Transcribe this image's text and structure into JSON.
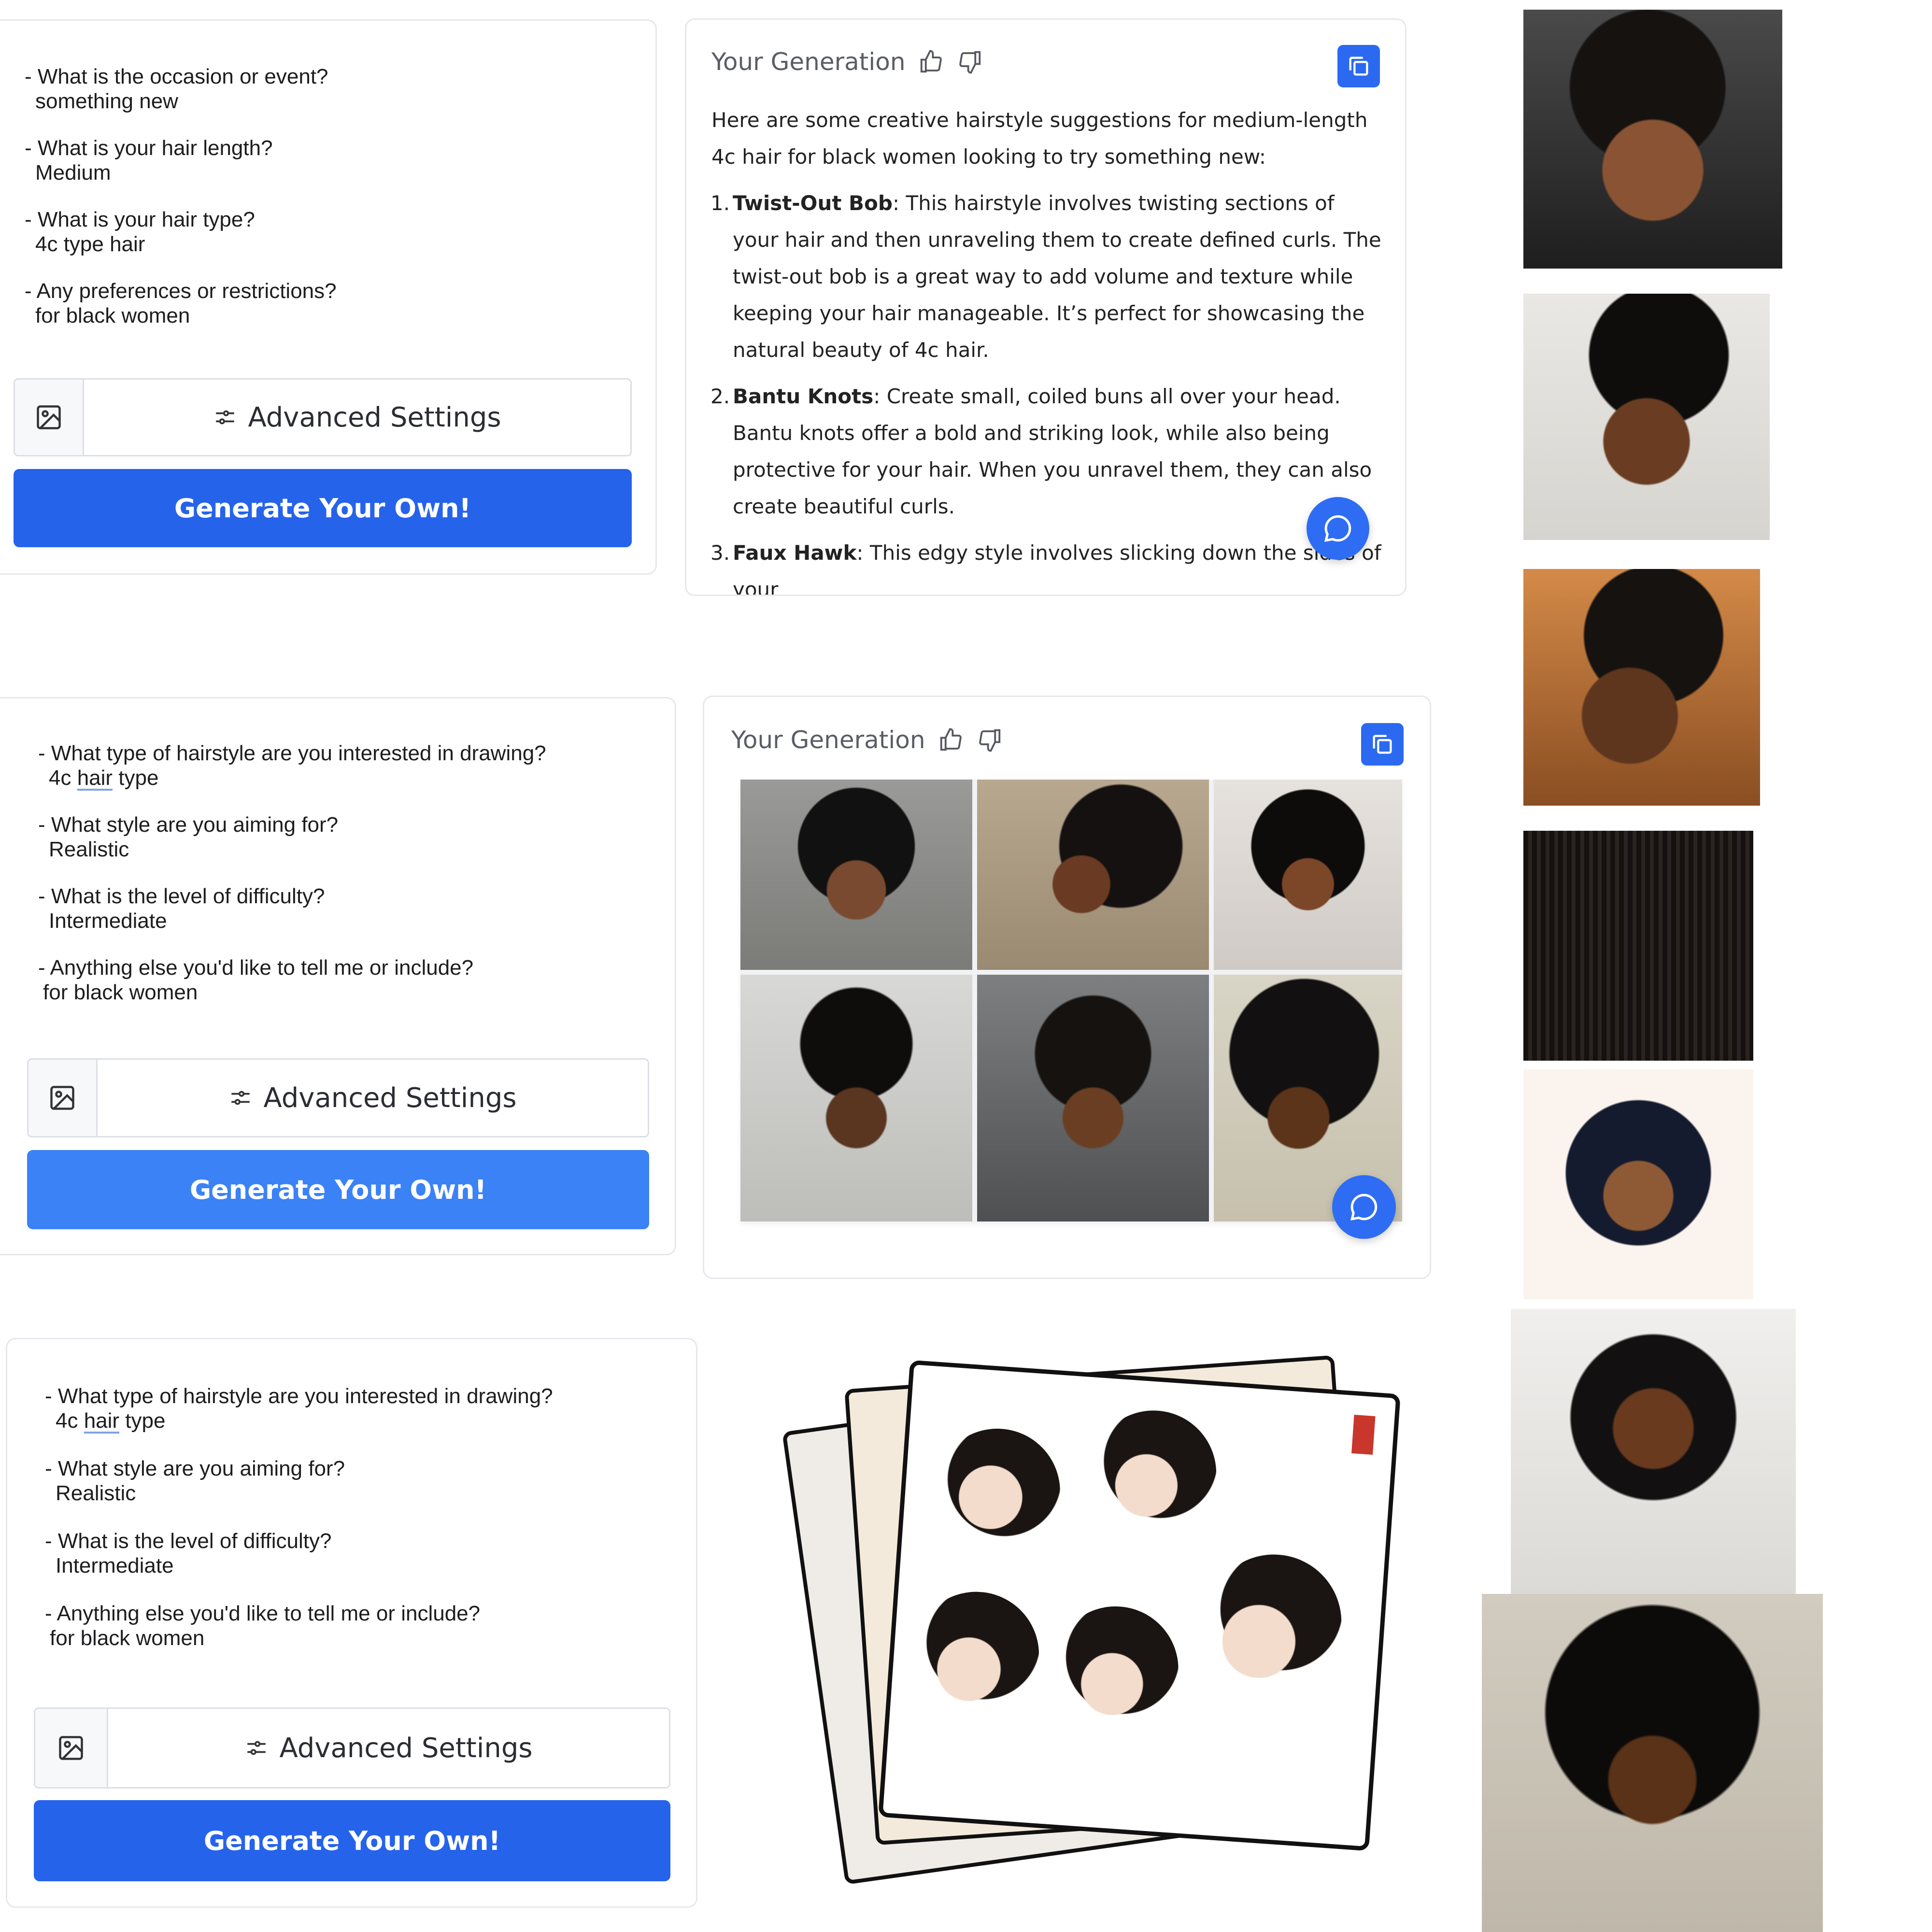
{
  "form1": {
    "q1": "- What is the occasion or event?",
    "a1": "something new",
    "q2": "- What is your hair length?",
    "a2": "Medium",
    "q3": "- What is your hair type?",
    "a3": "4c type hair",
    "q4": "- Any preferences or restrictions?",
    "a4": "for black women",
    "advanced_label": "Advanced Settings",
    "generate_label": "Generate Your Own!"
  },
  "form2": {
    "q1": "- What type of hairstyle are you interested in drawing?",
    "a1_pre": "4c ",
    "a1_hair": "hair",
    "a1_post": " type",
    "q2": "- What style are you aiming for?",
    "a2": "Realistic",
    "q3": "- What is the level of difficulty?",
    "a3": "Intermediate",
    "q4": "- Anything else you'd like to tell me or include?",
    "a4": "for black women",
    "advanced_label": "Advanced Settings",
    "generate_label": "Generate Your Own!"
  },
  "form3": {
    "q1": "- What type of hairstyle are you interested in drawing?",
    "a1_pre": "4c ",
    "a1_hair": "hair",
    "a1_post": " type",
    "q2": "- What style are you aiming for?",
    "a2": "Realistic",
    "q3": "- What is the level of difficulty?",
    "a3": "Intermediate",
    "q4": "- Anything else you'd like to tell me or include?",
    "a4": "for black women",
    "advanced_label": "Advanced Settings",
    "generate_label": "Generate Your Own!"
  },
  "generation1": {
    "title": "Your Generation",
    "intro": "Here are some creative hairstyle suggestions for medium-length 4c hair for black women looking to try something new:",
    "items": [
      {
        "num": "1.",
        "name": "Twist-Out Bob",
        "text": ": This hairstyle involves twisting sections of your hair and then unraveling them to create defined curls. The twist-out bob is a great way to add volume and texture while keeping your hair manageable. It’s perfect for showcasing the natural beauty of 4c hair."
      },
      {
        "num": "2.",
        "name": "Bantu Knots",
        "text": ": Create small, coiled buns all over your head. Bantu knots offer a bold and striking look, while also being protective for your hair. When you unravel them, they can also create beautiful curls."
      },
      {
        "num": "3.",
        "name": "Faux Hawk",
        "text": ": This edgy style involves slicking down the sides of your"
      }
    ]
  },
  "generation2": {
    "title": "Your Generation"
  },
  "icons": {
    "thumbs_up": "thumbs-up-icon",
    "thumbs_down": "thumbs-down-icon",
    "copy": "copy-icon",
    "chat": "chat-bubble-icon",
    "image": "image-icon",
    "sliders": "sliders-icon"
  },
  "colors": {
    "primary_button": "#2563eb",
    "primary_button_light": "#3b82f6",
    "accent_icon": "#2b6af0"
  }
}
